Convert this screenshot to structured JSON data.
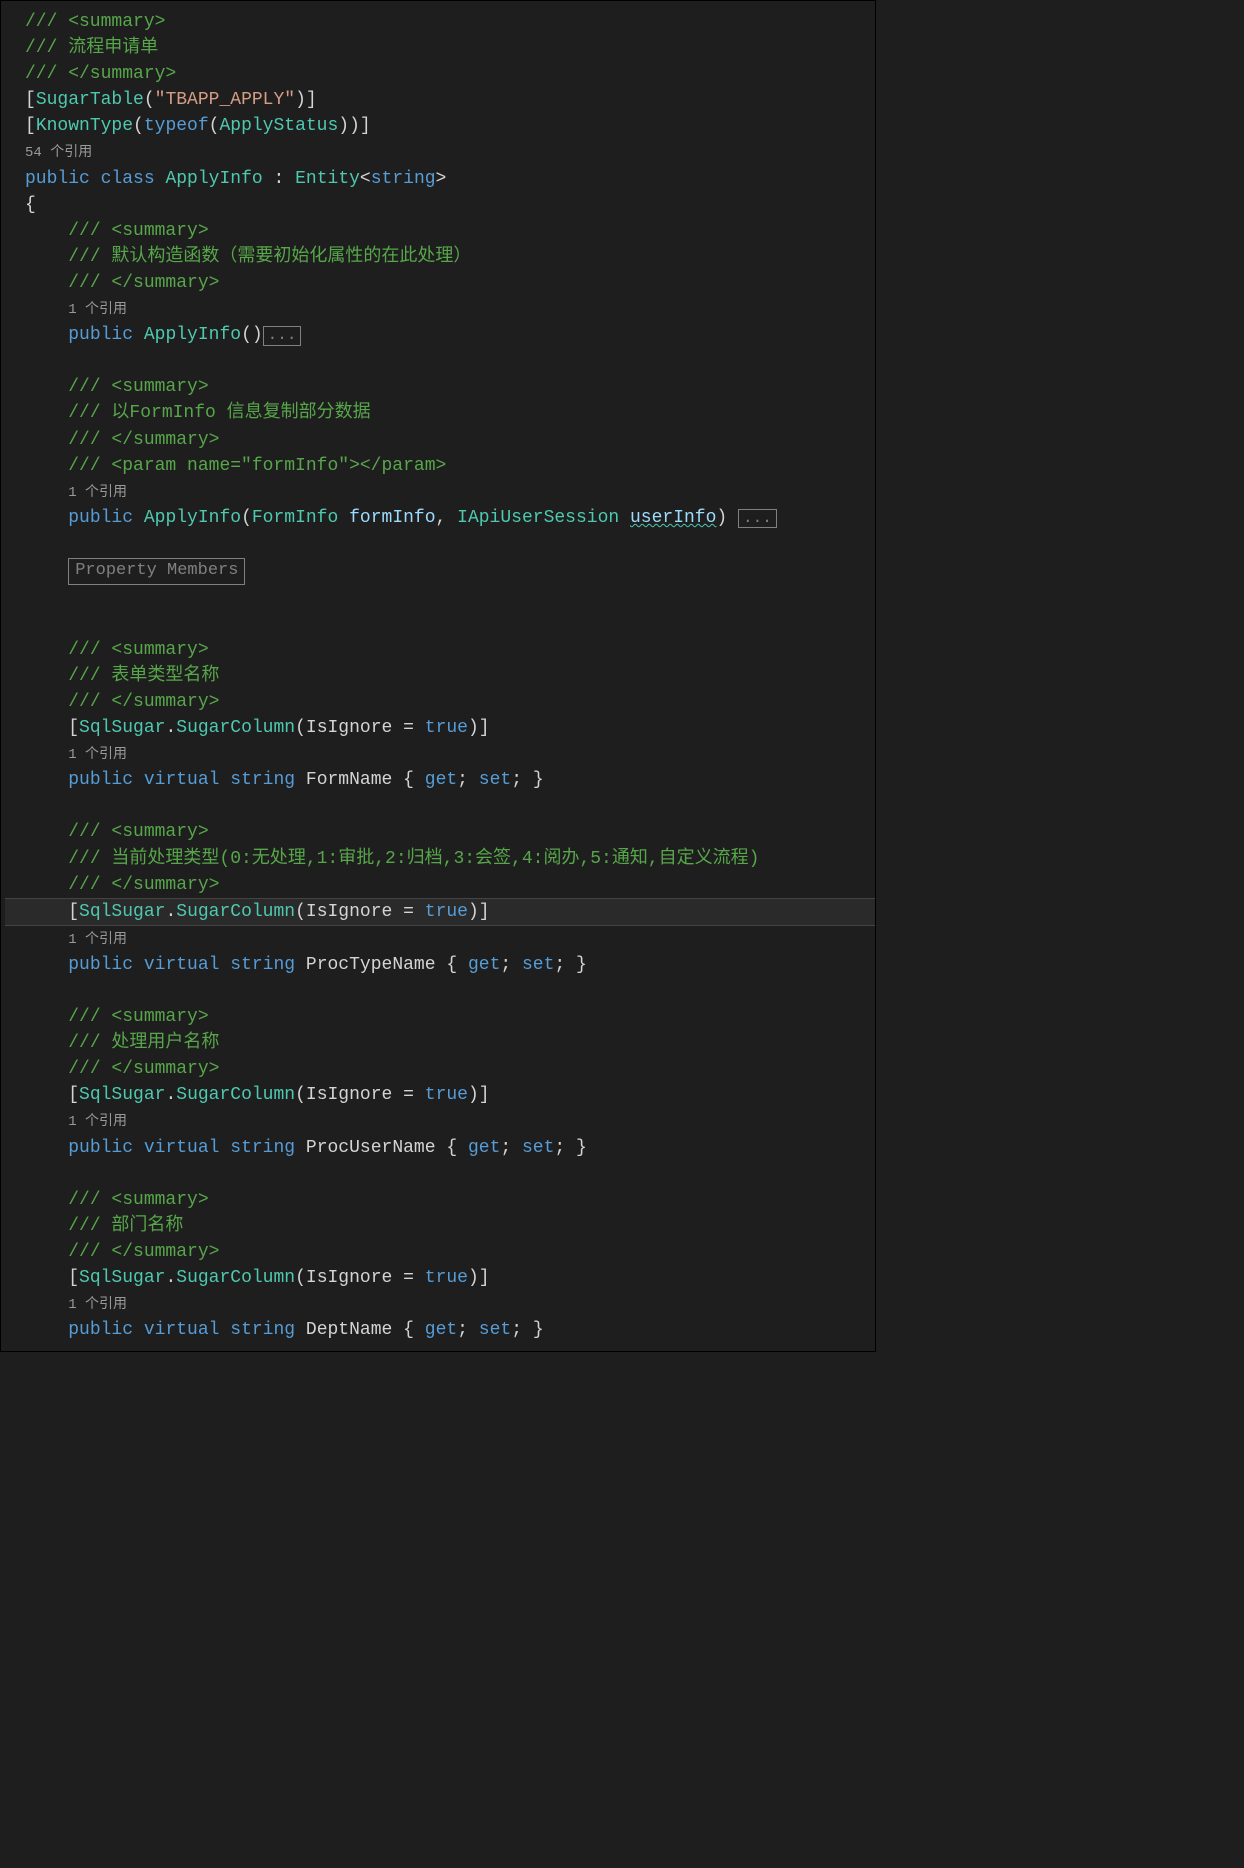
{
  "comments": {
    "summary_open": "/// <summary>",
    "summary_close": "/// </summary>",
    "class_desc": "/// 流程申请单",
    "ctor_default": "/// 默认构造函数（需要初始化属性的在此处理）",
    "ctor_form": "/// 以FormInfo 信息复制部分数据",
    "param_open": "/// <param name=",
    "param_name": "\"formInfo\"",
    "param_close": "></param>",
    "prop_formname": "/// 表单类型名称",
    "prop_proctype": "/// 当前处理类型(0:无处理,1:审批,2:归档,3:会签,4:阅办,5:通知,自定义流程)",
    "prop_procuser": "/// 处理用户名称",
    "prop_dept": "/// 部门名称"
  },
  "attrs": {
    "sugar_table_open": "SugarTable",
    "sugar_table_arg": "\"TBAPP_APPLY\"",
    "known_type_open": "KnownType",
    "typeof_kw": "typeof",
    "apply_status": "ApplyStatus",
    "sql_sugar": "SqlSugar",
    "sugar_column": "SugarColumn",
    "is_ignore": "IsIgnore",
    "true_kw": "true"
  },
  "codelens": {
    "ref54": "54 个引用",
    "ref1": "1 个引用"
  },
  "kw": {
    "public": "public",
    "class": "class",
    "virtual": "virtual",
    "string": "string",
    "get": "get",
    "set": "set"
  },
  "types": {
    "ApplyInfo": "ApplyInfo",
    "Entity": "Entity",
    "FormInfo": "FormInfo",
    "IApiUserSession": "IApiUserSession"
  },
  "idents": {
    "formInfo": "formInfo",
    "userInfo": "userInfo",
    "FormName": "FormName",
    "ProcTypeName": "ProcTypeName",
    "ProcUserName": "ProcUserName",
    "DeptName": "DeptName"
  },
  "region": "Property Members",
  "collapse": "..."
}
